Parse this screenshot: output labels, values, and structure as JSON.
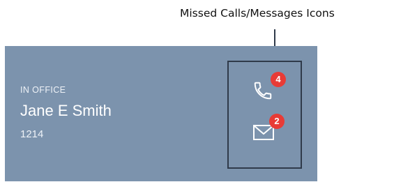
{
  "callout": {
    "label": "Missed Calls/Messages Icons"
  },
  "contact": {
    "status": "IN OFFICE",
    "name": "Jane E Smith",
    "extension": "1214"
  },
  "notifications": {
    "missed_calls": {
      "icon": "phone-icon",
      "count": "4"
    },
    "messages": {
      "icon": "envelope-icon",
      "count": "2"
    }
  },
  "colors": {
    "card_background": "#7c93ad",
    "badge": "#e83b36",
    "outline": "#2f3a4a"
  }
}
